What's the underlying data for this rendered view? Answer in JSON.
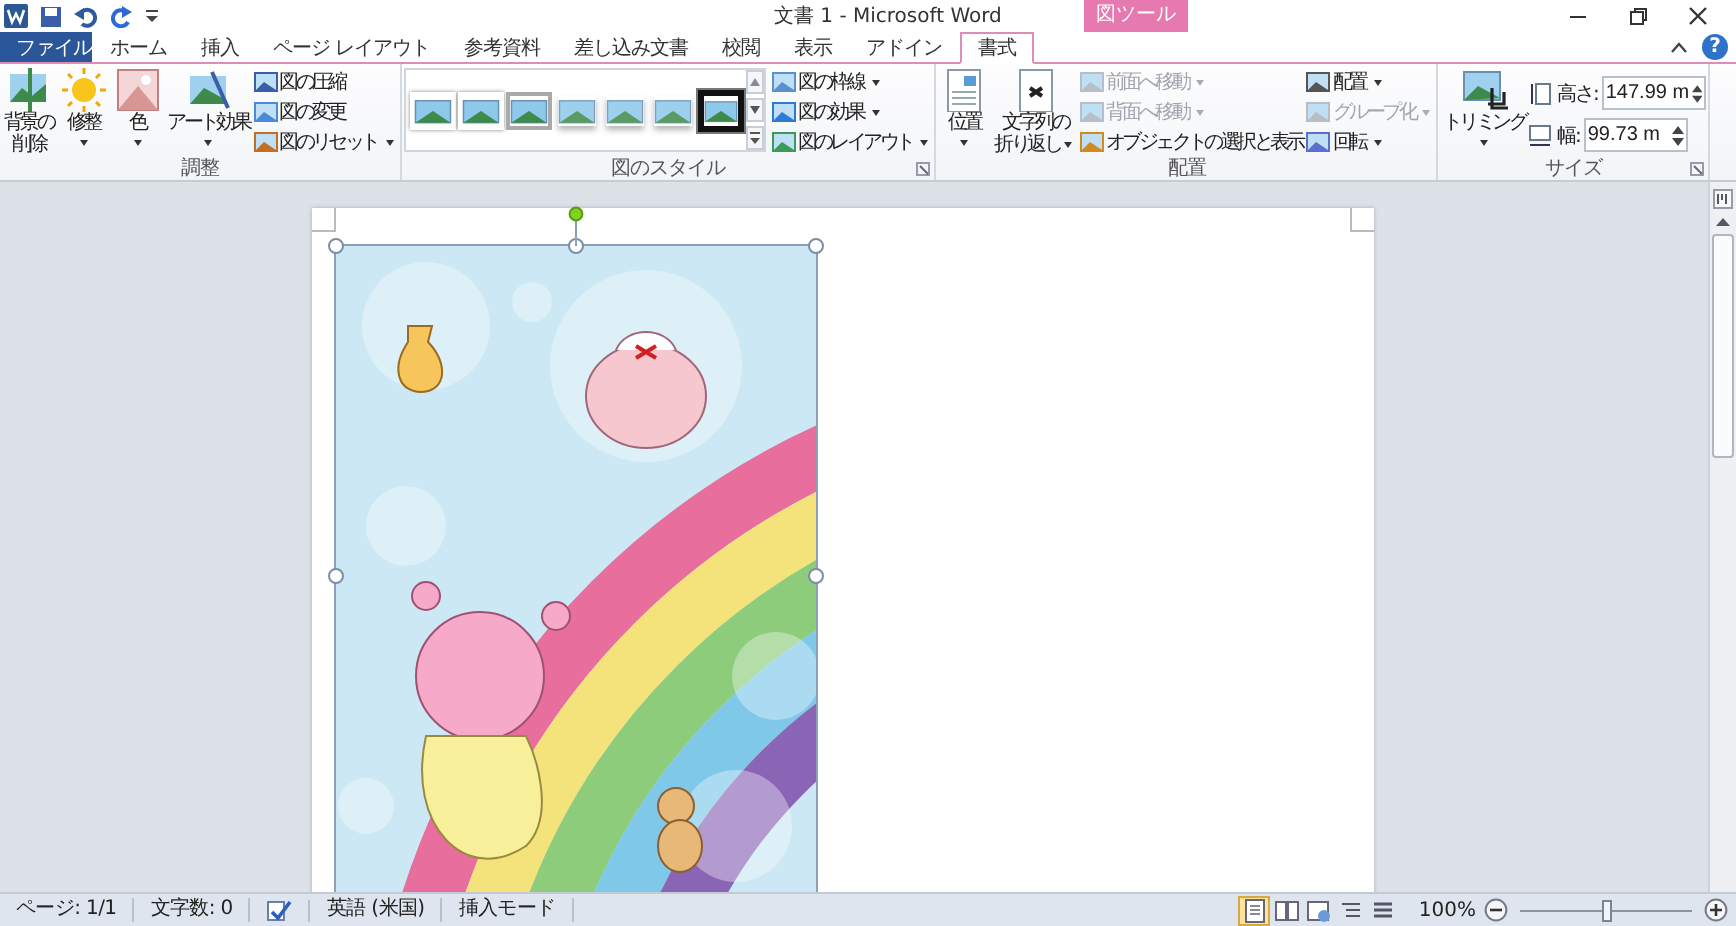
{
  "window": {
    "title": "文書 1 - Microsoft Word",
    "context_tool": "図ツール",
    "help": "?"
  },
  "tabs": [
    {
      "label": "ファイル",
      "kind": "file",
      "selected": false
    },
    {
      "label": "ホーム",
      "kind": "normal",
      "selected": false
    },
    {
      "label": "挿入",
      "kind": "normal",
      "selected": false
    },
    {
      "label": "ページ レイアウト",
      "kind": "normal",
      "selected": false
    },
    {
      "label": "参考資料",
      "kind": "normal",
      "selected": false
    },
    {
      "label": "差し込み文書",
      "kind": "normal",
      "selected": false
    },
    {
      "label": "校閲",
      "kind": "normal",
      "selected": false
    },
    {
      "label": "表示",
      "kind": "normal",
      "selected": false
    },
    {
      "label": "アドイン",
      "kind": "normal",
      "selected": false
    },
    {
      "label": "書式",
      "kind": "context",
      "selected": true
    }
  ],
  "ribbon": [
    {
      "label": "調整",
      "launcher": false,
      "columns": [
        {
          "kind": "large",
          "label": [
            "背景の",
            "削除"
          ],
          "dropdown": false,
          "disabled": false
        },
        {
          "kind": "large",
          "label": "修整",
          "dropdown": true,
          "disabled": false
        },
        {
          "kind": "large",
          "label": "色",
          "dropdown": true,
          "disabled": false
        },
        {
          "kind": "large",
          "label": "アート効果",
          "dropdown": true,
          "disabled": false
        },
        {
          "kind": "small",
          "items": [
            {
              "label": "図の圧縮",
              "dropdown": false,
              "disabled": false
            },
            {
              "label": "図の変更",
              "dropdown": false,
              "disabled": false
            },
            {
              "label": "図のリセット",
              "dropdown": true,
              "disabled": false
            }
          ]
        }
      ]
    },
    {
      "label": "図のスタイル",
      "launcher": true,
      "columns": [
        {
          "kind": "gallery",
          "items": [
            {
              "kind": "white-frame"
            },
            {
              "kind": "white-frame"
            },
            {
              "kind": "grey-frame"
            },
            {
              "kind": "soft-edge"
            },
            {
              "kind": "soft-edge"
            },
            {
              "kind": "soft-edge"
            },
            {
              "kind": "black-frame"
            }
          ]
        },
        {
          "kind": "small",
          "items": [
            {
              "label": "図の枠線",
              "dropdown": true,
              "disabled": false
            },
            {
              "label": "図の効果",
              "dropdown": true,
              "disabled": false
            },
            {
              "label": "図のレイアウト",
              "dropdown": true,
              "disabled": false
            }
          ]
        }
      ]
    },
    {
      "label": "配置",
      "launcher": false,
      "columns": [
        {
          "kind": "large",
          "label": "位置",
          "dropdown": true,
          "disabled": false
        },
        {
          "kind": "large",
          "label": [
            "文字列の",
            "折り返し"
          ],
          "dropdown": true,
          "disabled": false
        },
        {
          "kind": "small",
          "items": [
            {
              "label": "前面へ移動",
              "dropdown": true,
              "disabled": true
            },
            {
              "label": "背面へ移動",
              "dropdown": true,
              "disabled": true
            },
            {
              "label": "オブジェクトの選択と表示",
              "dropdown": false,
              "disabled": false
            }
          ]
        },
        {
          "kind": "small",
          "items": [
            {
              "label": "配置",
              "dropdown": true,
              "disabled": false
            },
            {
              "label": "グループ化",
              "dropdown": true,
              "disabled": true
            },
            {
              "label": "回転",
              "dropdown": true,
              "disabled": false
            }
          ]
        }
      ]
    },
    {
      "label": "サイズ",
      "launcher": true,
      "columns": [
        {
          "kind": "large",
          "label": "トリミング",
          "dropdown": true,
          "disabled": false
        },
        {
          "kind": "fields",
          "items": [
            {
              "label": "高さ:",
              "value": "147.99 m"
            },
            {
              "label": "幅:",
              "value": "99.73 m"
            }
          ]
        }
      ]
    }
  ],
  "status_bar": {
    "page": "ページ: 1/1",
    "words": "文字数: 0",
    "language": "英語 (米国)",
    "mode": "挿入モード",
    "views": [
      {
        "selected": true
      },
      {
        "selected": false
      },
      {
        "selected": false
      },
      {
        "selected": false
      },
      {
        "selected": false
      }
    ],
    "zoom": "100%",
    "zoom_slider": {
      "level": 0.5
    }
  }
}
